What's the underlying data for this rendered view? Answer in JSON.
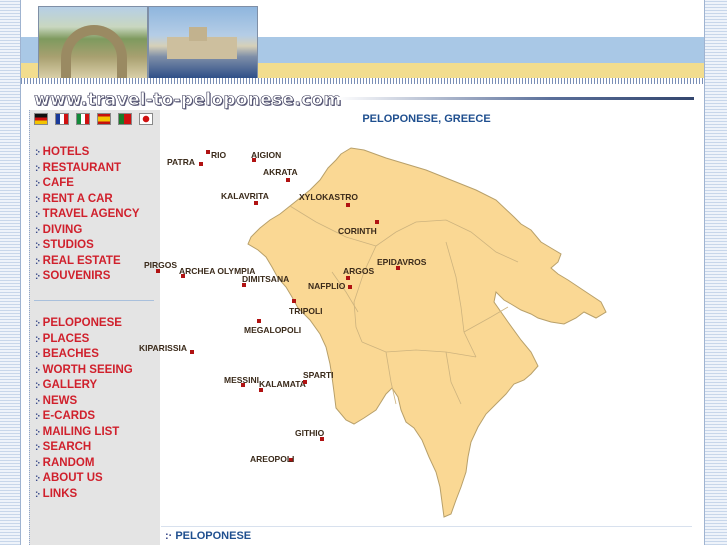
{
  "site": {
    "logo_text": "www.travel-to-peloponese.com"
  },
  "flags": [
    "german-flag",
    "french-flag",
    "italian-flag",
    "spanish-flag",
    "portuguese-flag",
    "japanese-flag"
  ],
  "menu_services": [
    "HOTELS",
    "RESTAURANT",
    "CAFE",
    "RENT A CAR",
    "TRAVEL AGENCY",
    "DIVING",
    "STUDIOS",
    "REAL ESTATE",
    "SOUVENIRS"
  ],
  "menu_site": [
    "PELOPONESE",
    "PLACES",
    "BEACHES",
    "WORTH SEEING",
    "GALLERY",
    "NEWS",
    "E-CARDS",
    "MAILING LIST",
    "SEARCH",
    "RANDOM",
    "ABOUT US",
    "LINKS"
  ],
  "content": {
    "title": "PELOPONESE, GREECE",
    "footer_link": "PELOPONESE"
  },
  "map": {
    "cities": [
      "PATRA",
      "RIO",
      "AIGION",
      "AKRATA",
      "KALAVRITA",
      "XYLOKASTRO",
      "CORINTH",
      "PIRGOS",
      "ARCHEA OLYMPIA",
      "DIMITSANA",
      "ARGOS",
      "EPIDAVROS",
      "NAFPLIO",
      "TRIPOLI",
      "MEGALOPOLI",
      "KIPARISSIA",
      "MESSINI",
      "KALAMATA",
      "SPARTI",
      "GITHIO",
      "AREOPOLI"
    ]
  },
  "colors": {
    "menu_red": "#d0202c",
    "title_blue": "#1f4f8f",
    "land": "#fad894",
    "sidebar_gray": "#e4e4e4"
  }
}
